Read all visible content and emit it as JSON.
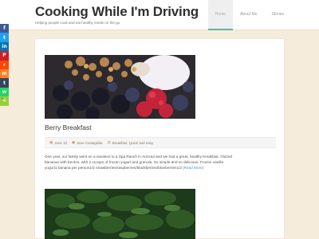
{
  "site": {
    "title": "Cooking While I'm Driving",
    "tagline": "Helping people cook and eat healthy meals on the go"
  },
  "nav": [
    {
      "label": "Home",
      "active": true
    },
    {
      "label": "About Me",
      "active": false
    },
    {
      "label": "Stories",
      "active": false
    }
  ],
  "share": [
    {
      "icon": "facebook-icon",
      "glyph": "f",
      "color": "#3b5998"
    },
    {
      "icon": "twitter-icon",
      "glyph": "t",
      "color": "#1da1f2"
    },
    {
      "icon": "linkedin-icon",
      "glyph": "in",
      "color": "#0077b5"
    },
    {
      "icon": "pinterest-icon",
      "glyph": "P",
      "color": "#cb2027"
    },
    {
      "icon": "reddit-icon",
      "glyph": "r",
      "color": "#ff4500"
    },
    {
      "icon": "mix-icon",
      "glyph": "m",
      "color": "#ff8226"
    },
    {
      "icon": "tumblr-icon",
      "glyph": "t",
      "color": "#35465c"
    },
    {
      "icon": "whatsapp-icon",
      "glyph": "w",
      "color": "#25d366"
    },
    {
      "icon": "sharethis-icon",
      "glyph": "<",
      "color": "#95d03a"
    }
  ],
  "share_toggle": "»",
  "post": {
    "title": "Berry Breakfast",
    "date": "June 10",
    "author": "Jane Costagliola",
    "categories": "Breakfast, Quick and easy",
    "excerpt": "One year, our family went on a vacation to a Spa Ranch in Arizona and we had a great, healthy breakfast. Glazed bananas with berries, with 2 scoops of frozen yogurt and granola. So simple and so delicious. Frozen vanilla yogurt1 banana per person1/2 strawberries/raspberries/blackberries/blueberries1/2",
    "read_more": "[Read More]"
  },
  "colors": {
    "accent": "#5fb3a6",
    "background": "#f6ecdc",
    "link": "#4a90c8"
  }
}
